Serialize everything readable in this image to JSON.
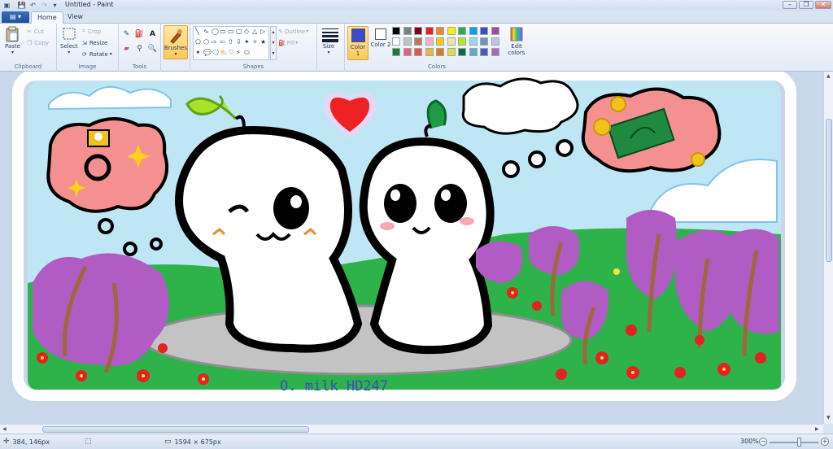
{
  "window": {
    "title": "Untitled - Paint",
    "minimize_glyph": "–",
    "maximize_glyph": "❐",
    "close_glyph": "✕"
  },
  "tabs": {
    "file_glyph": "▤ ▾",
    "items": [
      {
        "label": "Home",
        "active": true
      },
      {
        "label": "View",
        "active": false
      }
    ]
  },
  "ribbon": {
    "clipboard": {
      "label": "Clipboard",
      "paste": "Paste",
      "cut": "Cut",
      "copy": "Copy"
    },
    "image": {
      "label": "Image",
      "select": "Select",
      "crop": "Crop",
      "resize": "Resize",
      "rotate": "Rotate"
    },
    "tools": {
      "label": "Tools",
      "icons": [
        "pencil-icon",
        "fill-icon",
        "text-icon",
        "eraser-icon",
        "color-picker-icon",
        "magnifier-icon"
      ],
      "text_glyph": "A"
    },
    "brushes": {
      "label": "Brushes"
    },
    "shapes": {
      "label": "Shapes",
      "outline": "Outline",
      "fill": "Fill",
      "glyphs": [
        "╲",
        "∿",
        "◯",
        "▭",
        "▭",
        "▢",
        "◇",
        "△",
        "▷",
        "⬠",
        "⬡",
        "⇨",
        "⇦",
        "⇧",
        "⇩",
        "✦",
        "✧",
        "★",
        "✶",
        "💬",
        "🗨",
        "⛅",
        "♡",
        "⚡",
        "⬭"
      ]
    },
    "size": {
      "label": "Size"
    },
    "colors": {
      "label": "Colors",
      "color1_label": "Color 1",
      "color2_label": "Color 2",
      "edit_colors": "Edit colors",
      "color1": "#3f48cc",
      "color2": "#ffffff",
      "palette": [
        "#000000",
        "#7f7f7f",
        "#880015",
        "#ed1c24",
        "#ff7f27",
        "#fff200",
        "#22b14c",
        "#00a2e8",
        "#3f48cc",
        "#a349a4",
        "#ffffff",
        "#c3c3c3",
        "#b97a57",
        "#ffaec9",
        "#ffc90e",
        "#efe4b0",
        "#b5e61d",
        "#99d9ea",
        "#7092be",
        "#c8bfe7",
        "#1a7a2e",
        "#f05d7a",
        "#e8524f",
        "#f0b33f",
        "#e07a16",
        "#e4d94a",
        "#0b6e3a",
        "#60a8d4",
        "#4b5bbd",
        "#b067ba"
      ]
    }
  },
  "canvas_text": {
    "signature": "O. milk   HD247"
  },
  "status": {
    "cursor_position": "384, 146px",
    "selection_size": "",
    "image_size": "1594 × 675px",
    "zoom": "300%"
  }
}
